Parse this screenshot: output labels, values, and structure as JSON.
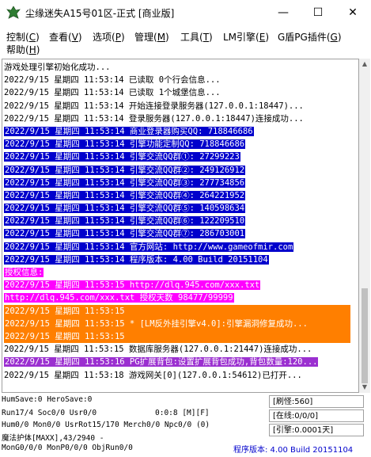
{
  "window": {
    "title": "尘缘迷失A15号01区-正式 [商业版]",
    "minimize": "—",
    "maximize": "☐",
    "close": "✕"
  },
  "menu": [
    {
      "label": "控制(",
      "key": "C",
      "end": ")"
    },
    {
      "label": "查看(",
      "key": "V",
      "end": ")"
    },
    {
      "label": "选项(",
      "key": "P",
      "end": ")"
    },
    {
      "label": "管理(",
      "key": "M",
      "end": ")"
    },
    {
      "label": "工具(",
      "key": "T",
      "end": ")"
    },
    {
      "label": "LM引擎(",
      "key": "E",
      "end": ")"
    },
    {
      "label": "G盾PG插件(",
      "key": "G",
      "end": ")"
    },
    {
      "label": "帮助(",
      "key": "H",
      "end": ")"
    }
  ],
  "log": [
    {
      "text": "游戏处理引擎初始化成功...",
      "style": ""
    },
    {
      "text": "2022/9/15 星期四 11:53:14 已读取 0个行会信息...",
      "style": ""
    },
    {
      "text": "2022/9/15 星期四 11:53:14 已读取 1个城堡信息...",
      "style": ""
    },
    {
      "text": "2022/9/15 星期四 11:53:14 开始连接登录服务器(127.0.0.1:18447)...",
      "style": ""
    },
    {
      "text": "2022/9/15 星期四 11:53:14 登录服务器(127.0.0.1:18447)连接成功...",
      "style": ""
    },
    {
      "text": "2022/9/15 星期四 11:53:14 商业登录器购买QQ: 718846686",
      "style": "blue"
    },
    {
      "text": "2022/9/15 星期四 11:53:14 引擎功能定制QQ: 718846686",
      "style": "blue"
    },
    {
      "text": "2022/9/15 星期四 11:53:14 引擎交流QQ群①: 27299223",
      "style": "blue"
    },
    {
      "text": "2022/9/15 星期四 11:53:14 引擎交流QQ群②: 249126912",
      "style": "blue"
    },
    {
      "text": "2022/9/15 星期四 11:53:14 引擎交流QQ群③: 277734856",
      "style": "blue"
    },
    {
      "text": "2022/9/15 星期四 11:53:14 引擎交流QQ群④: 264221952",
      "style": "blue"
    },
    {
      "text": "2022/9/15 星期四 11:53:14 引擎交流QQ群⑤: 140598634",
      "style": "blue"
    },
    {
      "text": "2022/9/15 星期四 11:53:14 引擎交流QQ群⑥: 122209510",
      "style": "blue"
    },
    {
      "text": "2022/9/15 星期四 11:53:14 引擎交流QQ群⑦: 286703001",
      "style": "blue"
    },
    {
      "text": "2022/9/15 星期四 11:53:14 官方网站: http://www.gameofmir.com",
      "style": "blue"
    },
    {
      "text": "2022/9/15 星期四 11:53:14 程序版本: 4.00 Build 20151104",
      "style": "blue"
    },
    {
      "text": "授权信息:",
      "style": "magenta"
    },
    {
      "text": "2022/9/15 星期四 11:53:15 http://dlq.945.com/xxx.txt",
      "style": "magenta"
    },
    {
      "text": "http://dlq.945.com/xxx.txt 授权天数 98477/99999",
      "style": "magenta"
    },
    {
      "text": "2022/9/15 星期四 11:53:15 ",
      "style": "orange full"
    },
    {
      "text": "2022/9/15 星期四 11:53:15 * [LM反外挂引擎v4.0]:引擎漏洞修复成功...",
      "style": "orange full"
    },
    {
      "text": "2022/9/15 星期四 11:53:15 ",
      "style": "orange full"
    },
    {
      "text": "2022/9/15 星期四 11:53:15 数据库服务器(127.0.0.1:21447)连接成功...",
      "style": ""
    },
    {
      "text": "2022/9/15 星期四 11:53:16 PG扩展背包:设置扩展背包成功,背包数量:120...",
      "style": "purple"
    },
    {
      "text": "2022/9/15 星期四 11:53:18 游戏网关[0](127.0.0.1:54612)已打开...",
      "style": ""
    }
  ],
  "status": {
    "line1": "HumSave:0 HeroSave:0",
    "line2": "Run17/4 Soc0/0 Usr0/0",
    "line2b": "0:0:8 [M][F]",
    "line3": "Hum0/0 Mon0/0 UsrRot15/170 Merch0/0 Npc0/0 (0)",
    "line4": "魔法护体[MAXX],43/2940 -",
    "line5": "MonG0/0/0 MonP0/0/0 ObjRun0/0",
    "refresh": "[刷怪:560]",
    "online": "[在线:0/0/0]",
    "engine": "[引擎:0.0001天]",
    "version": "程序版本: 4.00 Build 20151104"
  }
}
